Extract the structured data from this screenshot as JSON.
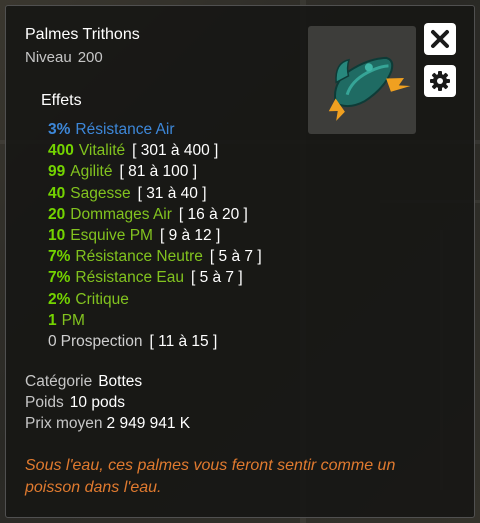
{
  "item": {
    "name": "Palmes Trithons",
    "level_label": "Niveau",
    "level": "200"
  },
  "icons": {
    "close": "close-icon",
    "settings": "gear-icon",
    "item": "swim-fins-icon"
  },
  "effects_heading": "Effets",
  "effects": [
    {
      "value": "3%",
      "label": "Résistance Air",
      "range": "",
      "color": "blue"
    },
    {
      "value": "400",
      "label": "Vitalité",
      "range": "[ 301 à 400 ]",
      "color": "green"
    },
    {
      "value": "99",
      "label": "Agilité",
      "range": "[ 81 à 100 ]",
      "color": "green"
    },
    {
      "value": "40",
      "label": "Sagesse",
      "range": "[ 31 à 40 ]",
      "color": "green"
    },
    {
      "value": "20",
      "label": "Dommages Air",
      "range": "[ 16 à 20 ]",
      "color": "green"
    },
    {
      "value": "10",
      "label": "Esquive PM",
      "range": "[ 9 à 12 ]",
      "color": "green"
    },
    {
      "value": "7%",
      "label": "Résistance Neutre",
      "range": "[ 5 à 7 ]",
      "color": "green"
    },
    {
      "value": "7%",
      "label": "Résistance Eau",
      "range": "[ 5 à 7 ]",
      "color": "green"
    },
    {
      "value": "2%",
      "label": "Critique",
      "range": "",
      "color": "green"
    },
    {
      "value": "1",
      "label": "PM",
      "range": "",
      "color": "green"
    },
    {
      "value": "0",
      "label": "Prospection",
      "range": "[ 11 à 15 ]",
      "color": "grey"
    }
  ],
  "category": {
    "label": "Catégorie",
    "value": "Bottes"
  },
  "weight": {
    "label": "Poids",
    "value": "10 pods"
  },
  "price": {
    "label": "Prix moyen",
    "value": "2 949 941 K"
  },
  "description": "Sous l'eau, ces palmes vous feront sentir comme un poisson dans l'eau.",
  "colors": {
    "blue": "#3d87d8",
    "green": "#82c31f",
    "value_green": "#74d400",
    "grey": "#cfcfcf",
    "description": "#e07a2f"
  }
}
